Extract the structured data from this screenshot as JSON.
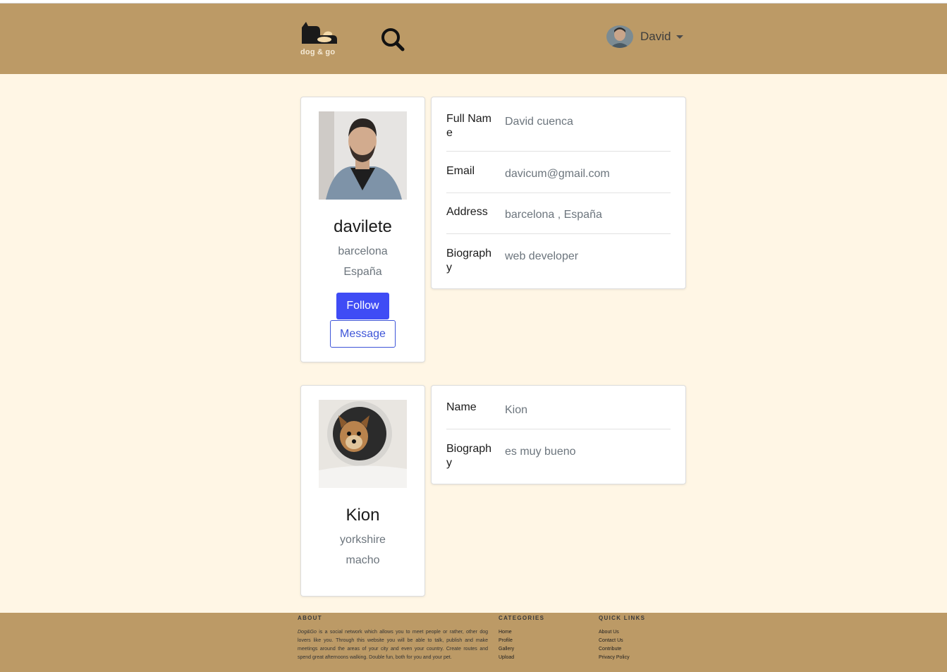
{
  "nav": {
    "logo_text": "dog & go",
    "user_name": "David"
  },
  "profile": {
    "username": "davilete",
    "city": "barcelona",
    "country": "España",
    "follow_label": "Follow",
    "message_label": "Message"
  },
  "profile_info": [
    {
      "label": "Full Name",
      "value": "David cuenca"
    },
    {
      "label": "Email",
      "value": "davicum@gmail.com"
    },
    {
      "label": "Address",
      "value": "barcelona , España"
    },
    {
      "label": "Biography",
      "value": "web developer"
    }
  ],
  "pet": {
    "name": "Kion",
    "breed": "yorkshire",
    "sex": "macho"
  },
  "pet_info": [
    {
      "label": "Name",
      "value": "Kion"
    },
    {
      "label": "Biography",
      "value": "es muy bueno"
    }
  ],
  "footer": {
    "about_heading": "ABOUT",
    "about_brand": "Dog&Go",
    "about_text": " is a social network which allows you to meet people or rather, other dog lovers like you. Through this website you will be able to talk, publish and make meetings around the areas of your city and even your country. Create routes and spend great afternoons walking. Double fun, both for you and your pet.",
    "categories_heading": "CATEGORIES",
    "categories": [
      "Home",
      "Profile",
      "Gallery",
      "Upload"
    ],
    "quicklinks_heading": "QUICK LINKS",
    "quicklinks": [
      "About Us",
      "Contact Us",
      "Contribute",
      "Privacy Policy"
    ]
  },
  "colors": {
    "navbar": "#bc9a66",
    "page_bg": "#fff6e5",
    "primary": "#3f4cf5",
    "muted": "#6c757d"
  }
}
